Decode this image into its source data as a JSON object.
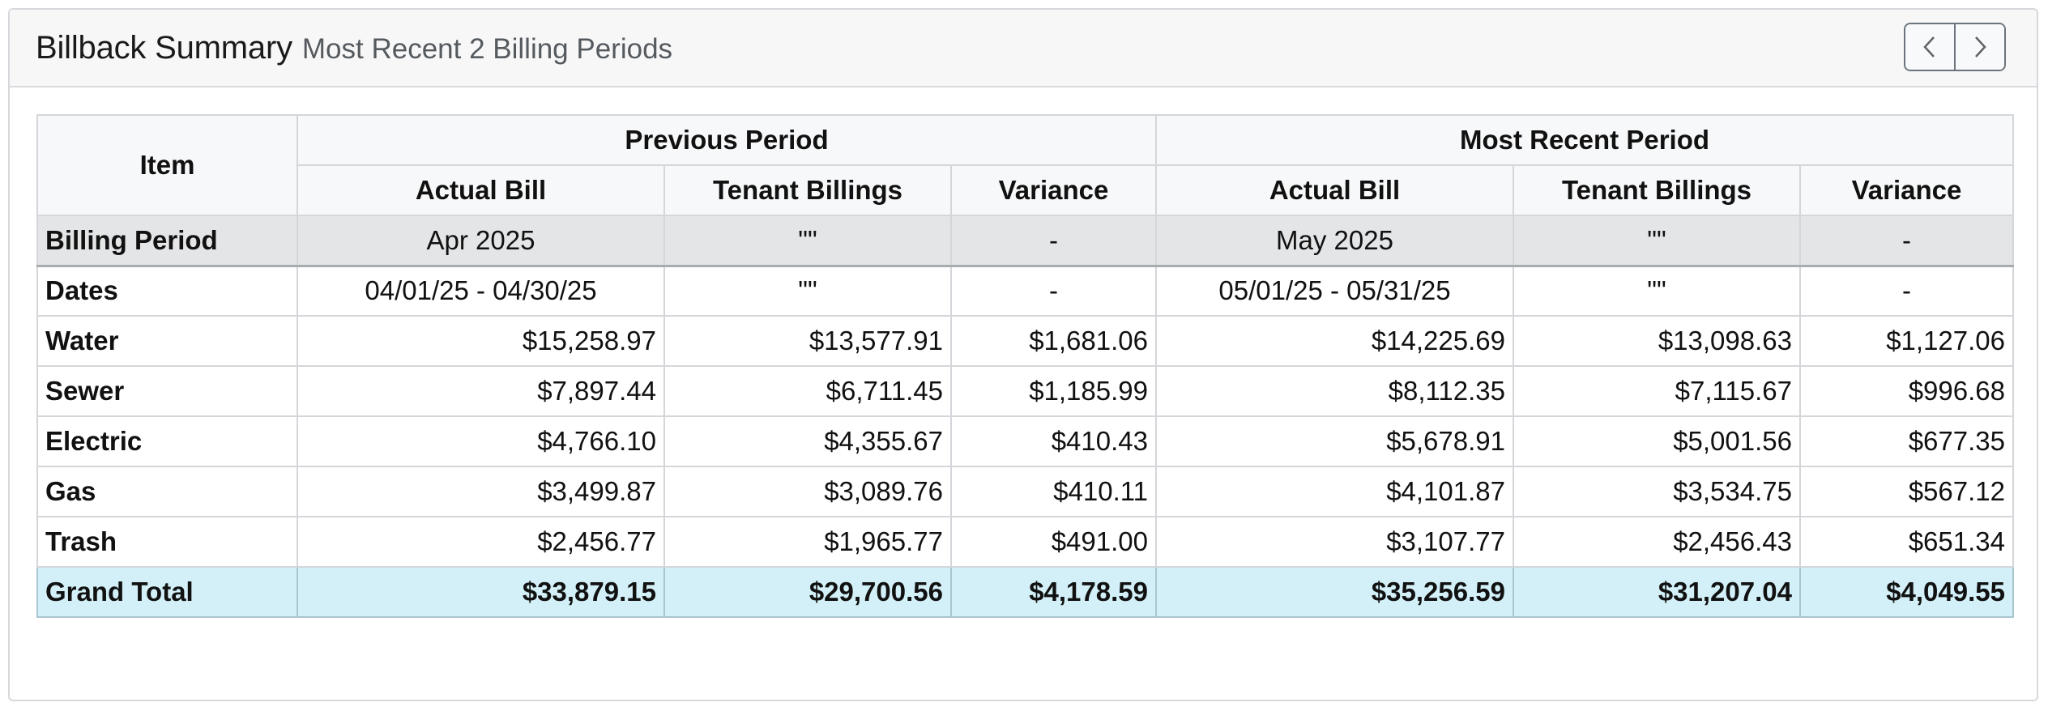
{
  "header": {
    "title": "Billback Summary",
    "subtitle": "Most Recent 2 Billing Periods",
    "prev_icon": "chevron-left-icon",
    "next_icon": "chevron-right-icon"
  },
  "table": {
    "item_header": "Item",
    "period_groups": [
      "Previous Period",
      "Most Recent Period"
    ],
    "sub_headers": [
      "Actual Bill",
      "Tenant Billings",
      "Variance",
      "Actual Bill",
      "Tenant Billings",
      "Variance"
    ],
    "period_row": {
      "label": "Billing Period",
      "cells": [
        "Apr 2025",
        "\"\"",
        "-",
        "May 2025",
        "\"\"",
        "-"
      ]
    },
    "dates_row": {
      "label": "Dates",
      "cells": [
        "04/01/25 - 04/30/25",
        "\"\"",
        "-",
        "05/01/25 - 05/31/25",
        "\"\"",
        "-"
      ]
    },
    "rows": [
      {
        "label": "Water",
        "cells": [
          "$15,258.97",
          "$13,577.91",
          "$1,681.06",
          "$14,225.69",
          "$13,098.63",
          "$1,127.06"
        ]
      },
      {
        "label": "Sewer",
        "cells": [
          "$7,897.44",
          "$6,711.45",
          "$1,185.99",
          "$8,112.35",
          "$7,115.67",
          "$996.68"
        ]
      },
      {
        "label": "Electric",
        "cells": [
          "$4,766.10",
          "$4,355.67",
          "$410.43",
          "$5,678.91",
          "$5,001.56",
          "$677.35"
        ]
      },
      {
        "label": "Gas",
        "cells": [
          "$3,499.87",
          "$3,089.76",
          "$410.11",
          "$4,101.87",
          "$3,534.75",
          "$567.12"
        ]
      },
      {
        "label": "Trash",
        "cells": [
          "$2,456.77",
          "$1,965.77",
          "$491.00",
          "$3,107.77",
          "$2,456.43",
          "$651.34"
        ]
      }
    ],
    "total_row": {
      "label": "Grand Total",
      "cells": [
        "$33,879.15",
        "$29,700.56",
        "$4,178.59",
        "$35,256.59",
        "$31,207.04",
        "$4,049.55"
      ]
    }
  },
  "colors": {
    "header_bg": "#f7f7f8",
    "period_row_bg": "#e4e5e7",
    "total_row_bg": "#d3f0f8",
    "border": "#d4d6d9"
  }
}
